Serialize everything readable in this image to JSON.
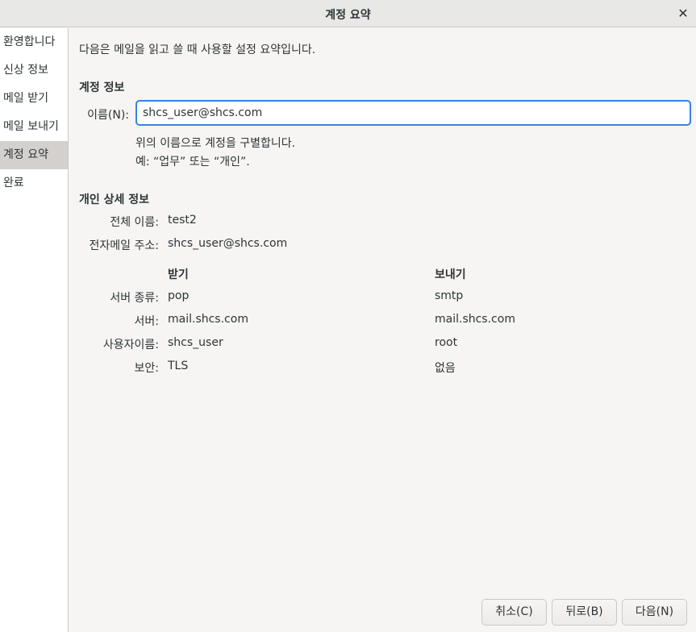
{
  "window": {
    "title": "계정 요약"
  },
  "sidebar": {
    "items": [
      {
        "label": "환영합니다"
      },
      {
        "label": "신상 정보"
      },
      {
        "label": "메일 받기"
      },
      {
        "label": "메일 보내기"
      },
      {
        "label": "계정 요약",
        "active": true
      },
      {
        "label": "완료"
      }
    ]
  },
  "main": {
    "intro": "다음은 메일을 읽고 쓸 때 사용할 설정 요약입니다.",
    "account_section": {
      "heading": "계정 정보",
      "name_label": "이름(N):",
      "name_value": "shcs_user@shcs.com",
      "hint_line1": "위의 이름으로 계정을 구별합니다.",
      "hint_line2": "예: “업무” 또는 “개인”."
    },
    "personal_section": {
      "heading": "개인 상세 정보",
      "fullname_label": "전체 이름:",
      "fullname_value": "test2",
      "email_label": "전자메일 주소:",
      "email_value": "shcs_user@shcs.com"
    },
    "server_table": {
      "col_receive": "받기",
      "col_send": "보내기",
      "rows": [
        {
          "label": "서버 종류:",
          "receive": "pop",
          "send": "smtp"
        },
        {
          "label": "서버:",
          "receive": "mail.shcs.com",
          "send": "mail.shcs.com"
        },
        {
          "label": "사용자이름:",
          "receive": "shcs_user",
          "send": "root"
        },
        {
          "label": "보안:",
          "receive": "TLS",
          "send": "없음"
        }
      ]
    }
  },
  "buttons": {
    "cancel": "취소(C)",
    "back": "뒤로(B)",
    "next": "다음(N)"
  }
}
